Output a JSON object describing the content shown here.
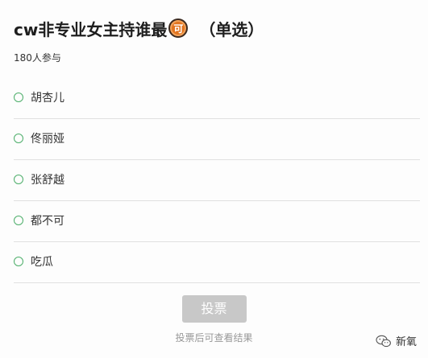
{
  "poll": {
    "title": "cw非专业女主持谁最",
    "badge": "可",
    "suffix": "（单选）",
    "participants": "180人参与",
    "options": [
      {
        "label": "胡杏儿"
      },
      {
        "label": "佟丽娅"
      },
      {
        "label": "张舒越"
      },
      {
        "label": "都不可"
      },
      {
        "label": "吃瓜"
      }
    ],
    "vote_button": "投票",
    "vote_note": "投票后可查看结果"
  },
  "watermark": {
    "text": "新氧",
    "icon": "wechat-icon"
  },
  "colors": {
    "radio_border": "#4dae6a",
    "button_bg": "#c8c8c8",
    "badge_bg": "#e2741f"
  }
}
